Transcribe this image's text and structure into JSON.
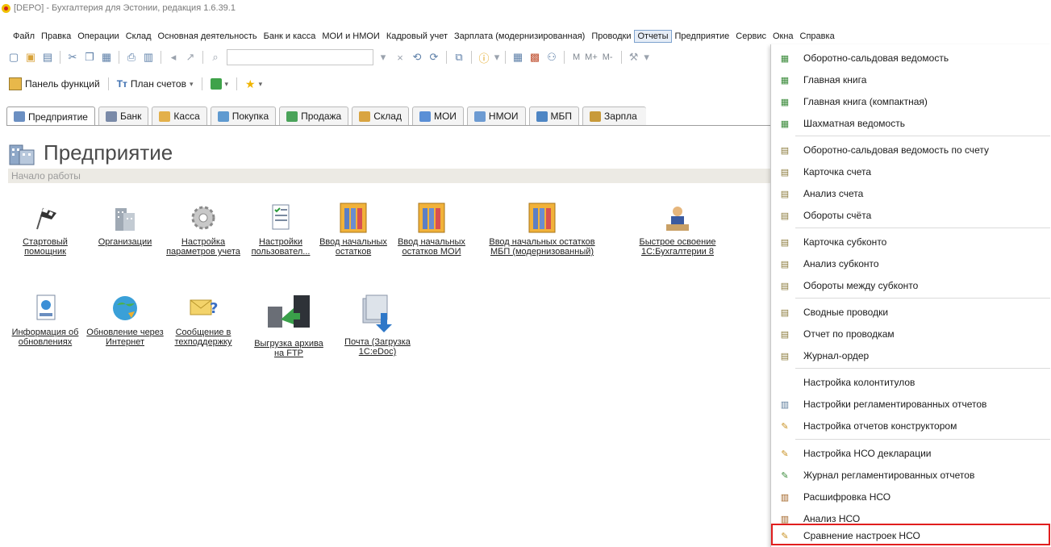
{
  "window": {
    "title": "[DEPO] - Бухгалтерия для Эстонии, редакция 1.6.39.1"
  },
  "menubar": {
    "items": [
      "Файл",
      "Правка",
      "Операции",
      "Склад",
      "Основная деятельность",
      "Банк и касса",
      "МОИ и НМОИ",
      "Кадровый учет",
      "Зарплата (модернизированная)",
      "Проводки",
      "Отчеты",
      "Предприятие",
      "Сервис",
      "Окна",
      "Справка"
    ]
  },
  "toolbar2": {
    "panel_label": "Панель функций",
    "plan_label": "План счетов"
  },
  "tabs": [
    "Предприятие",
    "Банк",
    "Касса",
    "Покупка",
    "Продажа",
    "Склад",
    "МОИ",
    "НМОИ",
    "МБП",
    "Зарпла"
  ],
  "section": {
    "title": "Предприятие",
    "subheader": "Начало работы"
  },
  "launch_row1": [
    "Стартовый помощник",
    "Организации",
    "Настройка параметров учета",
    "Настройки пользовател...",
    "Ввод начальных остатков",
    "Ввод начальных остатков МОИ",
    "Ввод начальных остатков МБП (модернизованный)",
    "Быстрое освоение 1С:Бухгалтерии 8"
  ],
  "launch_row2": [
    "Информация об обновлениях",
    "Обновление через Интернет",
    "Сообщение в техподдержку",
    "Выгрузка архива на FTP",
    "Почта (Загрузка 1C:eDoc)"
  ],
  "reports_menu": {
    "items": [
      "Оборотно-сальдовая ведомость",
      "Главная книга",
      "Главная книга (компактная)",
      "Шахматная ведомость",
      "Оборотно-сальдовая ведомость по счету",
      "Карточка счета",
      "Анализ счета",
      "Обороты счёта",
      "Карточка субконто",
      "Анализ субконто",
      "Обороты между субконто",
      "Сводные проводки",
      "Отчет по проводкам",
      "Журнал-ордер",
      "Настройка колонтитулов",
      "Настройки регламентированных отчетов",
      "Настройка отчетов конструктором",
      "Настройка НСО декларации",
      "Журнал регламентированных отчетов",
      "Расшифровка НСО",
      "Анализ НСО",
      "Сравнение настроек НСО"
    ],
    "highlight_color": "#e11e1e"
  }
}
